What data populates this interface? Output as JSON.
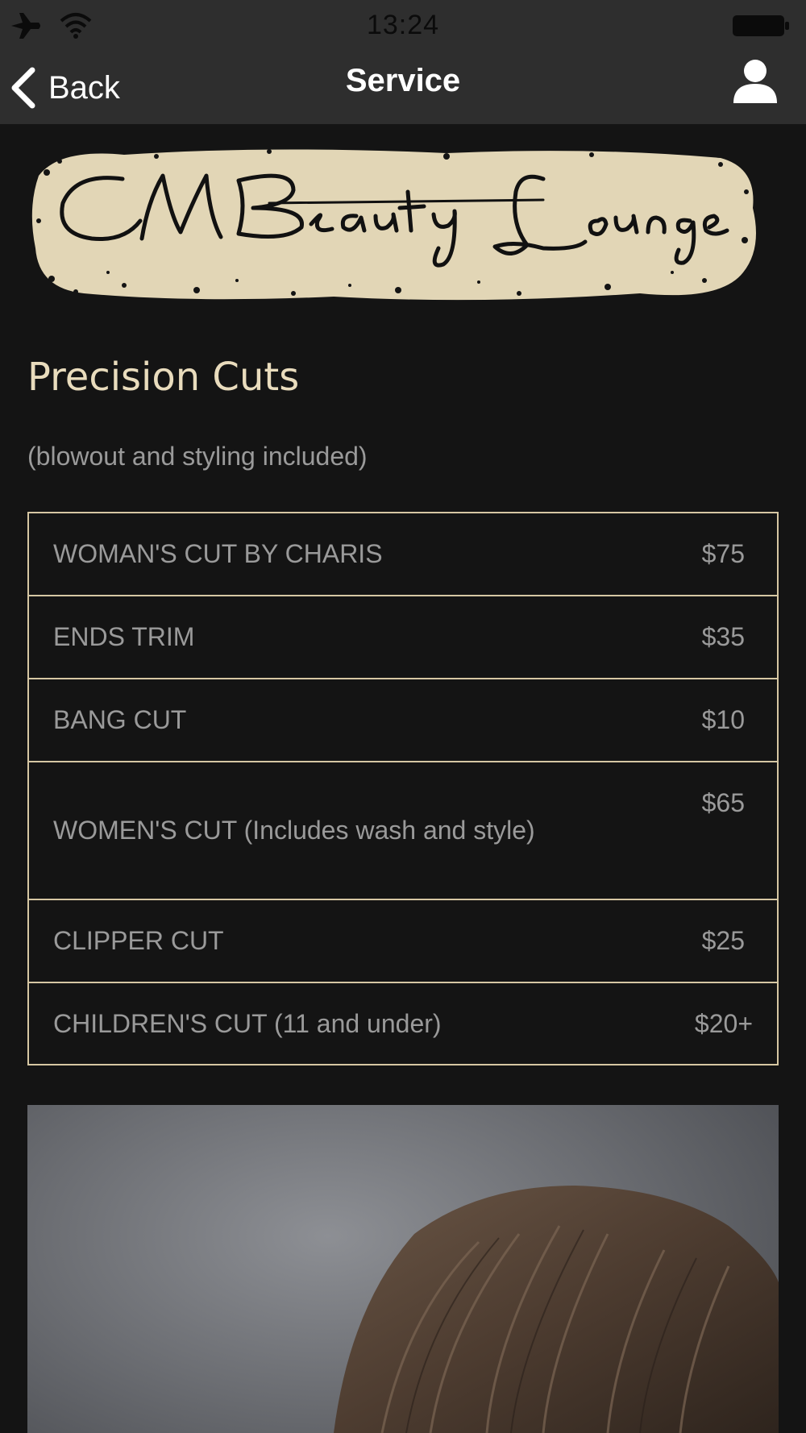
{
  "status_bar": {
    "time": "13:24",
    "icons": [
      "airplane-icon",
      "wifi-icon",
      "battery-icon"
    ]
  },
  "nav": {
    "back_label": "Back",
    "title": "Service",
    "user_icon": "user-icon"
  },
  "logo": {
    "text": "CMBeauty Lounge"
  },
  "section": {
    "title": "Precision Cuts",
    "subtitle": "(blowout and styling included)"
  },
  "services": [
    {
      "name": "WOMAN'S CUT BY CHARIS",
      "price": "$75"
    },
    {
      "name": "ENDS TRIM",
      "price": "$35"
    },
    {
      "name": "BANG CUT",
      "price": "$10"
    },
    {
      "name": "WOMEN'S CUT (Includes wash and style)",
      "price": "$65"
    },
    {
      "name": "CLIPPER CUT",
      "price": "$25"
    },
    {
      "name": "CHILDREN'S CUT (11 and under)",
      "price": "$20+"
    }
  ],
  "colors": {
    "background": "#141414",
    "bar": "#2e2e2e",
    "accent": "#e9dcbd",
    "border": "#d6c7a3",
    "text": "#9a9a9a"
  }
}
